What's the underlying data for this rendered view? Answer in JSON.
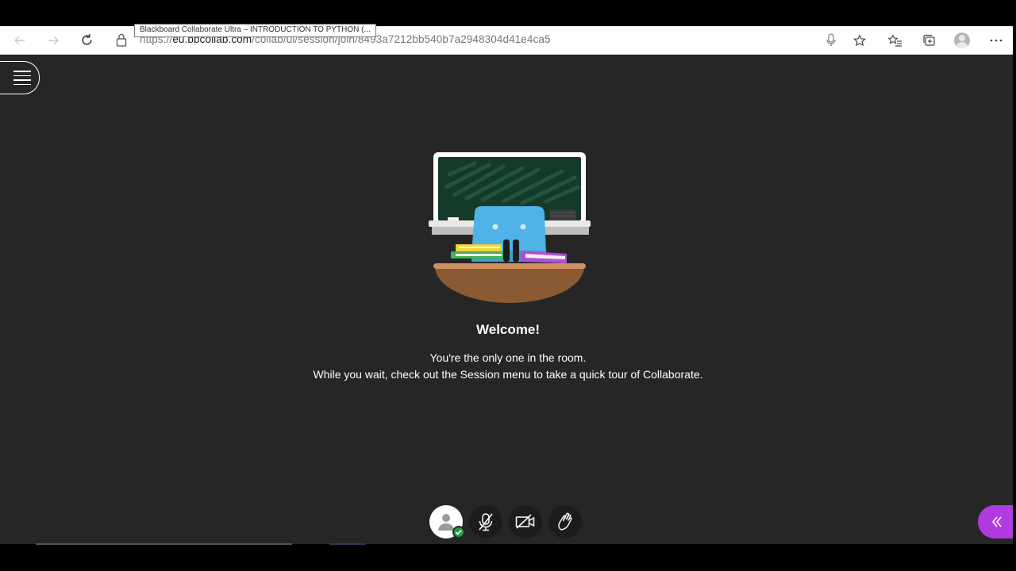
{
  "browser": {
    "tooltip": "Blackboard Collaborate Ultra – INTRODUCTION TO PYTHON (...",
    "url_prefix": "https://",
    "url_host": "eu.bbcollab.com",
    "url_path": "/collab/ui/session/join/8493a7212bb540b7a2948304d41e4ca5",
    "buttons": [
      "back-icon",
      "forward-icon",
      "refresh-icon",
      "microphone-icon",
      "favorite-star-icon",
      "favorites-list-icon",
      "collections-icon",
      "profile-icon",
      "more-icon"
    ]
  },
  "session": {
    "menu_icon": "hamburger-icon"
  },
  "welcome": {
    "title": "Welcome!",
    "line1": "You're the only one in the room.",
    "line2": "While you wait, check out the Session menu to take a quick tour of Collaborate."
  },
  "controls": {
    "items": [
      "my-status-avatar-icon",
      "microphone-off-icon",
      "camera-off-icon",
      "raise-hand-icon"
    ],
    "status": "available"
  },
  "colors": {
    "app_bg": "#262626",
    "accent": "#b03be0",
    "status_green": "#2a9d3f",
    "chalkboard": "#163a2a"
  }
}
